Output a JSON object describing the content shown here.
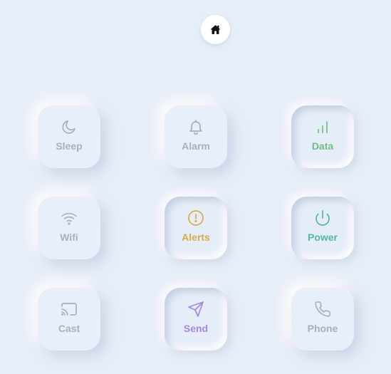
{
  "home": {
    "icon": "home-icon"
  },
  "tiles": [
    {
      "label": "Sleep",
      "icon": "moon-icon",
      "active": false,
      "color": "#a5b0c3"
    },
    {
      "label": "Alarm",
      "icon": "bell-icon",
      "active": false,
      "color": "#a5b0c3"
    },
    {
      "label": "Data",
      "icon": "signal-bars-icon",
      "active": true,
      "color": "#6fbe8a"
    },
    {
      "label": "Wifi",
      "icon": "wifi-icon",
      "active": false,
      "color": "#a5b0c3"
    },
    {
      "label": "Alerts",
      "icon": "alert-circle-icon",
      "active": true,
      "color": "#d7a94f"
    },
    {
      "label": "Power",
      "icon": "power-icon",
      "active": true,
      "color": "#55b79b"
    },
    {
      "label": "Cast",
      "icon": "cast-icon",
      "active": false,
      "color": "#a5b0c3"
    },
    {
      "label": "Send",
      "icon": "send-icon",
      "active": true,
      "color": "#a489d9"
    },
    {
      "label": "Phone",
      "icon": "phone-icon",
      "active": false,
      "color": "#a5b0c3"
    }
  ]
}
